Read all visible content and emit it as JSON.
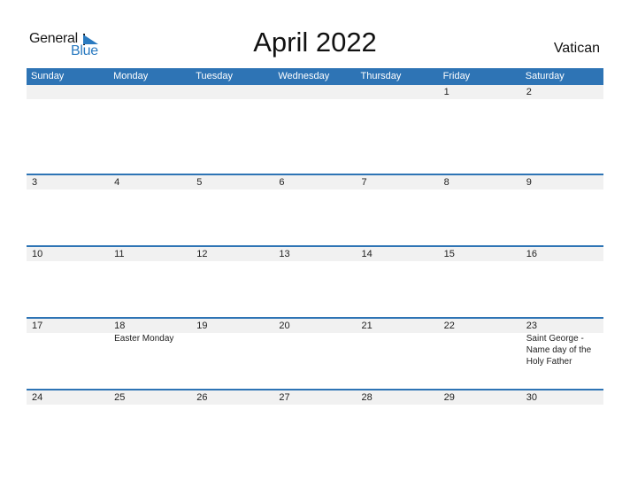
{
  "logo": {
    "text_general": "General",
    "text_blue": "Blue",
    "icon": "triangle-flag-icon",
    "accent_color": "#2a7ac0"
  },
  "title": "April 2022",
  "country": "Vatican",
  "colors": {
    "header_bg": "#2e74b5",
    "row_band": "#f1f1f1"
  },
  "weekdays": [
    "Sunday",
    "Monday",
    "Tuesday",
    "Wednesday",
    "Thursday",
    "Friday",
    "Saturday"
  ],
  "weeks": [
    {
      "days": [
        "",
        "",
        "",
        "",
        "",
        "1",
        "2"
      ],
      "events": [
        "",
        "",
        "",
        "",
        "",
        "",
        ""
      ]
    },
    {
      "days": [
        "3",
        "4",
        "5",
        "6",
        "7",
        "8",
        "9"
      ],
      "events": [
        "",
        "",
        "",
        "",
        "",
        "",
        ""
      ]
    },
    {
      "days": [
        "10",
        "11",
        "12",
        "13",
        "14",
        "15",
        "16"
      ],
      "events": [
        "",
        "",
        "",
        "",
        "",
        "",
        ""
      ]
    },
    {
      "days": [
        "17",
        "18",
        "19",
        "20",
        "21",
        "22",
        "23"
      ],
      "events": [
        "",
        "Easter Monday",
        "",
        "",
        "",
        "",
        "Saint George - Name day of the Holy Father"
      ]
    },
    {
      "days": [
        "24",
        "25",
        "26",
        "27",
        "28",
        "29",
        "30"
      ],
      "events": [
        "",
        "",
        "",
        "",
        "",
        "",
        ""
      ]
    }
  ]
}
